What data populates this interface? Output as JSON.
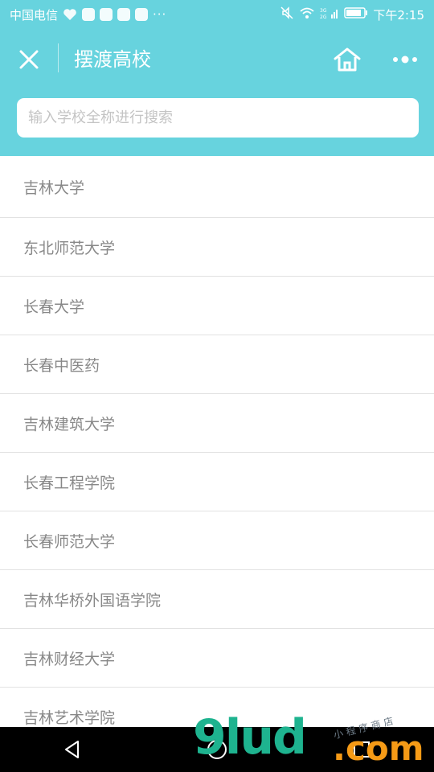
{
  "status_bar": {
    "carrier": "中国电信",
    "more": "···",
    "time": "下午2:15",
    "signal_label": "3G 2G"
  },
  "header": {
    "title": "摆渡高校",
    "close_icon": "close-icon",
    "home_icon": "home-icon",
    "more_icon": "more-dots-icon"
  },
  "search": {
    "placeholder": "输入学校全称进行搜索",
    "value": ""
  },
  "schools": [
    "吉林大学",
    "东北师范大学",
    "长春大学",
    "长春中医药",
    "吉林建筑大学",
    "长春工程学院",
    "长春师范大学",
    "吉林华桥外国语学院",
    "吉林财经大学",
    "吉林艺术学院"
  ],
  "nav": {
    "back_icon": "back-triangle-icon",
    "home_icon": "home-circle-icon",
    "recent_icon": "recent-square-icon"
  },
  "watermark": {
    "main": "9lud",
    "domain": ".com",
    "tagline": "小程序商店"
  },
  "colors": {
    "header_bg": "#67d3de",
    "list_text": "#888888",
    "divider": "#e2e2e2",
    "nav_bg": "#000000"
  }
}
